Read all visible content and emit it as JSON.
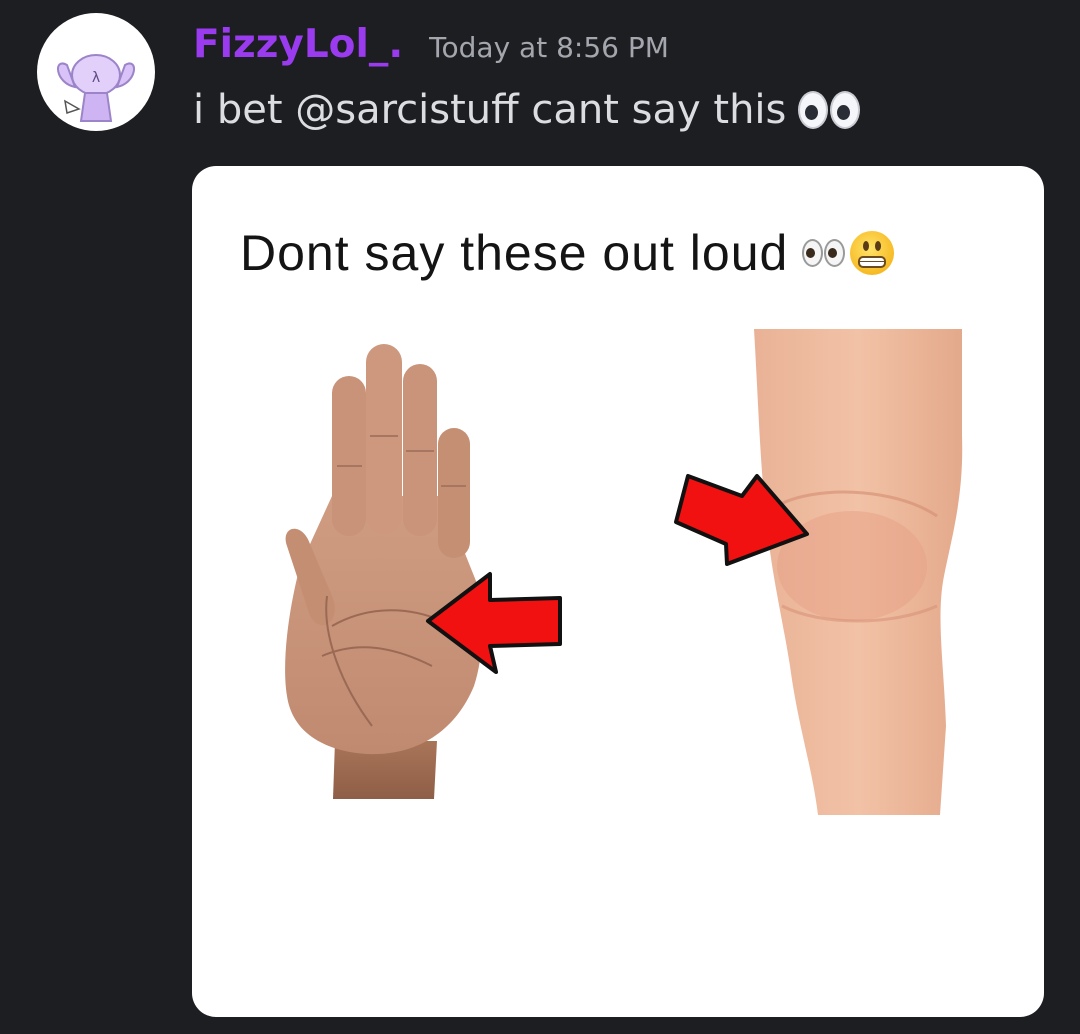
{
  "message": {
    "author": "FizzyLol_.",
    "timestamp": "Today at 8:56 PM",
    "text": "i bet @sarcistuff cant say this",
    "text_emoji": "eyes-emoji",
    "author_color": "#9b3bf0"
  },
  "avatar": {
    "icon": "lambda-character-avatar",
    "lettering": "λ"
  },
  "attachment": {
    "caption": "Dont say these out loud",
    "caption_emojis": [
      "eyes-emoji",
      "grimacing-face-emoji"
    ],
    "panels": [
      {
        "subject": "palm-of-hand",
        "arrow": "red-arrow-pointing-left"
      },
      {
        "subject": "knee",
        "arrow": "red-arrow-pointing-right"
      }
    ],
    "arrow_color": "#f21111",
    "background": "#ffffff"
  },
  "theme": {
    "background": "#1d1e22",
    "text_color": "#dcdde1",
    "muted_color": "#a4a6ae"
  }
}
